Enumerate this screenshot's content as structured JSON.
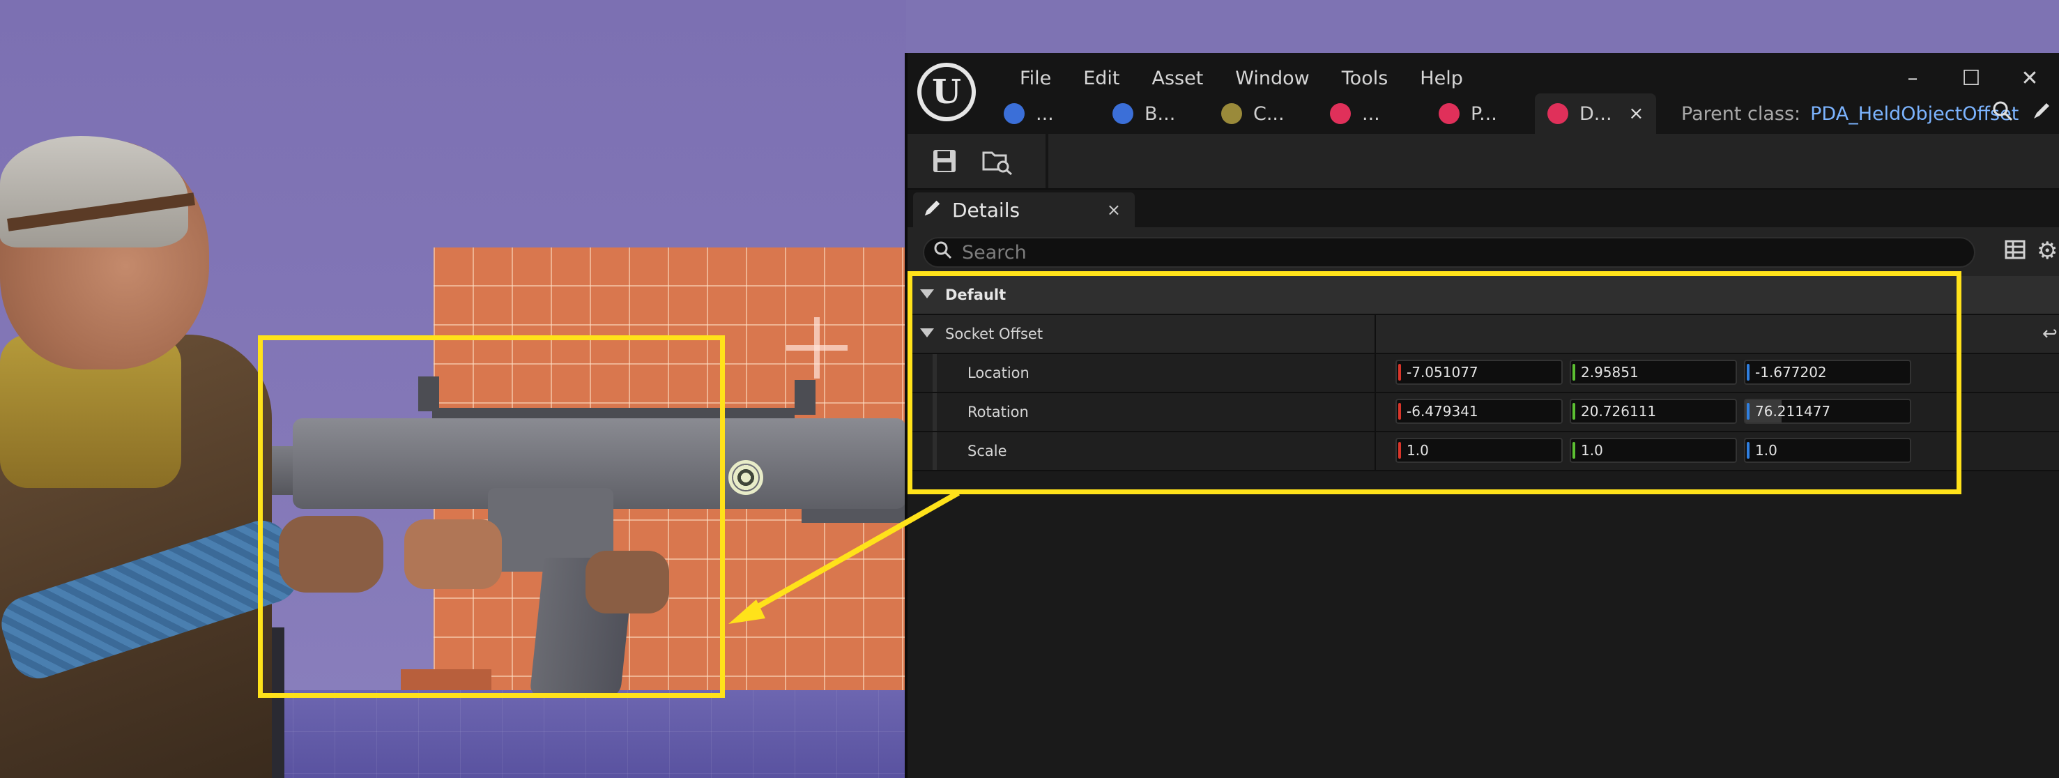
{
  "menu": {
    "file": "File",
    "edit": "Edit",
    "asset": "Asset",
    "window": "Window",
    "tools": "Tools",
    "help": "Help"
  },
  "window_controls": {
    "minimize": "–",
    "maximize": "☐",
    "close": "✕"
  },
  "tabs": [
    {
      "label": "...",
      "icon_color": "#3b6fd8",
      "icon": "character-blueprint-icon"
    },
    {
      "label": "B...",
      "icon_color": "#3b6fd8",
      "icon": "blueprint-icon"
    },
    {
      "label": "C...",
      "icon_color": "#9a8a3a",
      "icon": "component-icon"
    },
    {
      "label": "...",
      "icon_color": "#e0305a",
      "icon": "data-asset-icon"
    },
    {
      "label": "P...",
      "icon_color": "#e0305a",
      "icon": "data-asset-icon"
    },
    {
      "label": "D...",
      "icon_color": "#e0305a",
      "icon": "data-asset-icon",
      "active": true,
      "close": "×"
    }
  ],
  "parent_class": {
    "label": "Parent class:",
    "value": "PDA_HeldObjectOffset"
  },
  "details_tab": {
    "label": "Details",
    "close": "×"
  },
  "search": {
    "placeholder": "Search"
  },
  "properties": {
    "category": "Default",
    "struct": "Socket Offset",
    "rows": [
      {
        "label": "Location",
        "x": "-7.051077",
        "y": "2.95851",
        "z": "-1.677202"
      },
      {
        "label": "Rotation",
        "x": "-6.479341",
        "y": "20.726111",
        "z": "76.211477"
      },
      {
        "label": "Scale",
        "x": "1.0",
        "y": "1.0",
        "z": "1.0"
      }
    ]
  },
  "colors": {
    "highlight": "#ffe21a",
    "axis_x": "#d8352a",
    "axis_y": "#5cc032",
    "axis_z": "#2f7fe0",
    "link": "#7cb4ff"
  }
}
